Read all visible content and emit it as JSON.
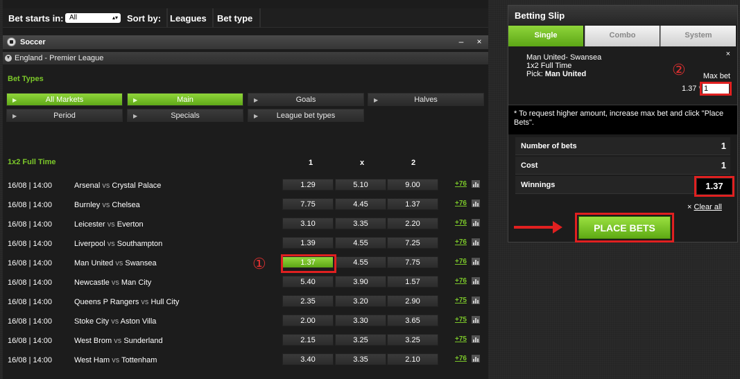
{
  "topbar": {
    "bet_starts_label": "Bet starts in:",
    "bet_starts_value": "All",
    "sort_by_label": "Sort by:",
    "leagues_label": "Leagues",
    "bet_type_label": "Bet type"
  },
  "sport_header": {
    "title": "Soccer",
    "minimize": "–",
    "close": "×"
  },
  "league_header": {
    "title": "England - Premier League"
  },
  "bet_types": {
    "title": "Bet Types",
    "buttons": [
      "All Markets",
      "Main",
      "Goals",
      "Halves",
      "Period",
      "Specials",
      "League bet types"
    ]
  },
  "market": {
    "title": "1x2 Full Time",
    "col1": "1",
    "colx": "x",
    "col2": "2"
  },
  "matches": [
    {
      "date": "16/08 | 14:00",
      "home": "Arsenal",
      "away": "Crystal Palace",
      "o1": "1.29",
      "ox": "5.10",
      "o2": "9.00",
      "more": "+76"
    },
    {
      "date": "16/08 | 14:00",
      "home": "Burnley",
      "away": "Chelsea",
      "o1": "7.75",
      "ox": "4.45",
      "o2": "1.37",
      "more": "+76"
    },
    {
      "date": "16/08 | 14:00",
      "home": "Leicester",
      "away": "Everton",
      "o1": "3.10",
      "ox": "3.35",
      "o2": "2.20",
      "more": "+76"
    },
    {
      "date": "16/08 | 14:00",
      "home": "Liverpool",
      "away": "Southampton",
      "o1": "1.39",
      "ox": "4.55",
      "o2": "7.25",
      "more": "+76"
    },
    {
      "date": "16/08 | 14:00",
      "home": "Man United",
      "away": "Swansea",
      "o1": "1.37",
      "ox": "4.55",
      "o2": "7.75",
      "more": "+76"
    },
    {
      "date": "16/08 | 14:00",
      "home": "Newcastle",
      "away": "Man City",
      "o1": "5.40",
      "ox": "3.90",
      "o2": "1.57",
      "more": "+76"
    },
    {
      "date": "16/08 | 14:00",
      "home": "Queens P Rangers",
      "away": "Hull City",
      "o1": "2.35",
      "ox": "3.20",
      "o2": "2.90",
      "more": "+75"
    },
    {
      "date": "16/08 | 14:00",
      "home": "Stoke City",
      "away": "Aston Villa",
      "o1": "2.00",
      "ox": "3.30",
      "o2": "3.65",
      "more": "+75"
    },
    {
      "date": "16/08 | 14:00",
      "home": "West Brom",
      "away": "Sunderland",
      "o1": "2.15",
      "ox": "3.25",
      "o2": "3.25",
      "more": "+75"
    },
    {
      "date": "16/08 | 14:00",
      "home": "West Ham",
      "away": "Tottenham",
      "o1": "3.40",
      "ox": "3.35",
      "o2": "2.10",
      "more": "+76"
    }
  ],
  "vs": "vs",
  "annotations": {
    "step1": "①",
    "step2": "②"
  },
  "slip": {
    "title": "Betting Slip",
    "tabs": [
      "Single",
      "Combo",
      "System"
    ],
    "bet_match": "Man United- Swansea",
    "bet_market": "1x2 Full Time",
    "bet_pick_label": "Pick:",
    "bet_pick": "Man United",
    "close": "×",
    "max_bet_label": "Max bet",
    "odds_times": "1.37 *",
    "stake": "1",
    "note": "* To request higher amount, increase max bet and click \"Place Bets\".",
    "num_bets_label": "Number of bets",
    "num_bets": "1",
    "cost_label": "Cost",
    "cost": "1",
    "winnings_label": "Winnings",
    "winnings": "1.37",
    "clear_x": "×",
    "clear_all": "Clear all",
    "place_bets": "PLACE BETS"
  },
  "colors": {
    "accent_green": "#7cc82a",
    "highlight_red": "#e02020"
  }
}
